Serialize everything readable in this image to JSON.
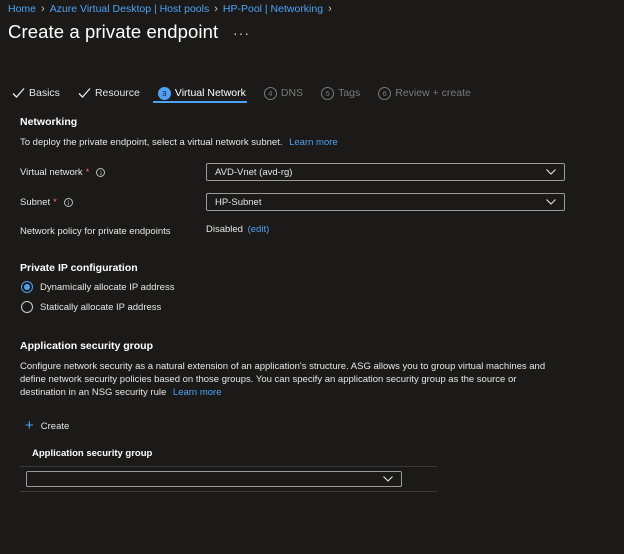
{
  "breadcrumb": [
    "Home",
    "Azure Virtual Desktop | Host pools",
    "HP-Pool | Networking"
  ],
  "page_title": "Create a private endpoint",
  "more_glyph": "···",
  "tabs": [
    {
      "label": "Basics",
      "state": "done"
    },
    {
      "label": "Resource",
      "state": "done"
    },
    {
      "number": "3",
      "label": "Virtual Network",
      "state": "active"
    },
    {
      "number": "4",
      "label": "DNS",
      "state": "disabled"
    },
    {
      "number": "5",
      "label": "Tags",
      "state": "disabled"
    },
    {
      "number": "6",
      "label": "Review + create",
      "state": "disabled"
    }
  ],
  "networking": {
    "heading": "Networking",
    "description": "To deploy the private endpoint, select a virtual network subnet.",
    "learn_more": "Learn more",
    "vnet_label": "Virtual network",
    "vnet_value": "AVD-Vnet (avd-rg)",
    "subnet_label": "Subnet",
    "subnet_value": "HP-Subnet",
    "policy_label": "Network policy for private endpoints",
    "policy_value": "Disabled",
    "policy_edit": "(edit)",
    "required_mark": "*",
    "info_glyph": "i"
  },
  "ip_config": {
    "heading": "Private IP configuration",
    "option_dynamic": "Dynamically allocate IP address",
    "option_static": "Statically allocate IP address",
    "selected": "dynamic"
  },
  "asg": {
    "heading": "Application security group",
    "description_1": "Configure network security as a natural extension of an application's structure. ASG allows you to group virtual machines and",
    "description_2": "define network security policies based on those groups. You can specify an application security group as the source or",
    "description_3": "destination in an NSG security rule",
    "learn_more": "Learn more",
    "create_label": "Create",
    "plus_glyph": "+",
    "column_header": "Application security group",
    "select_value": ""
  },
  "colors": {
    "accent": "#4ea1f3",
    "background": "#1b1a19",
    "required": "#f1707b"
  }
}
